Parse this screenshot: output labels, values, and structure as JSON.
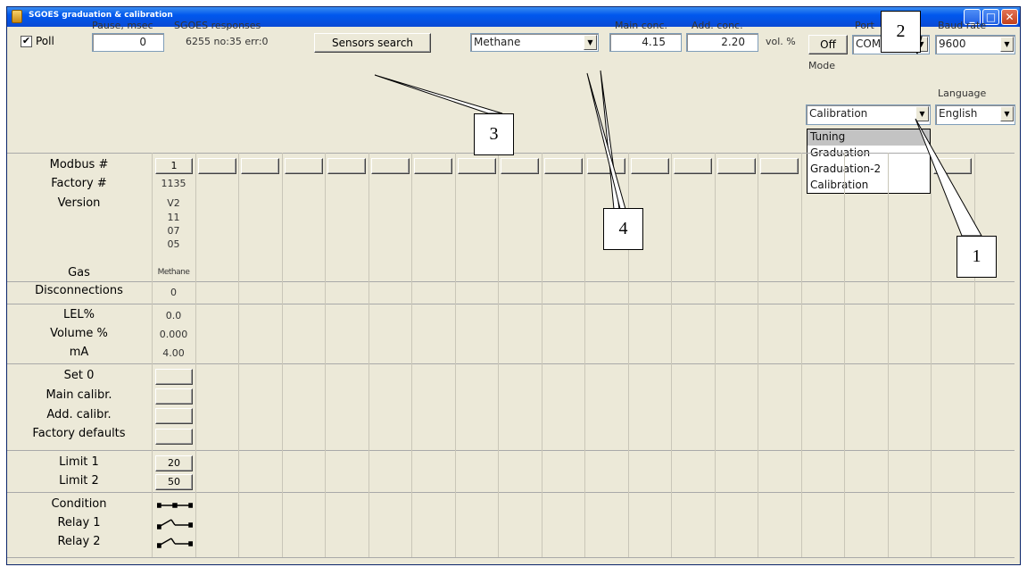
{
  "window": {
    "title": "SGOES graduation & calibration"
  },
  "poll": {
    "label": "Poll",
    "checked_mark": "✔"
  },
  "pause": {
    "label": "Pause, msec",
    "value": "0"
  },
  "responses": {
    "label": "SGOES responses",
    "value": "6255 no:35 err:0"
  },
  "sensors_search": {
    "label": "Sensors search"
  },
  "gas_select": {
    "value": "Methane"
  },
  "conc": {
    "main_label": "Main conc.",
    "main_value": "4.15",
    "add_label": "Add. conc.",
    "add_value": "2.20",
    "unit": "vol. %"
  },
  "port": {
    "label": "Port",
    "off_label": "Off",
    "value": "COM2"
  },
  "baud": {
    "label": "Baud rate",
    "value": "9600"
  },
  "mode": {
    "label": "Mode",
    "value": "Calibration",
    "options": [
      "Tuning",
      "Graduation",
      "Graduation-2",
      "Calibration"
    ]
  },
  "language": {
    "label": "Language",
    "value": "English"
  },
  "table": {
    "labels": {
      "modbus": "Modbus #",
      "factory": "Factory #",
      "version": "Version",
      "gas": "Gas",
      "disconnections": "Disconnections",
      "lel": "LEL%",
      "volume": "Volume %",
      "ma": "mA",
      "set0": "Set 0",
      "main_calibr": "Main calibr.",
      "add_calibr": "Add. calibr.",
      "factory_defaults": "Factory defaults",
      "limit1": "Limit 1",
      "limit2": "Limit 2",
      "condition": "Condition",
      "relay1": "Relay 1",
      "relay2": "Relay 2"
    },
    "col1": {
      "modbus": "1",
      "factory": "1135",
      "version": [
        "V2",
        "11",
        "07",
        "05"
      ],
      "gas": "Methane",
      "disconnections": "0",
      "lel": "0.0",
      "volume": "0.000",
      "ma": "4.00",
      "limit1": "20",
      "limit2": "50"
    }
  },
  "callouts": [
    "1",
    "2",
    "3",
    "4"
  ]
}
